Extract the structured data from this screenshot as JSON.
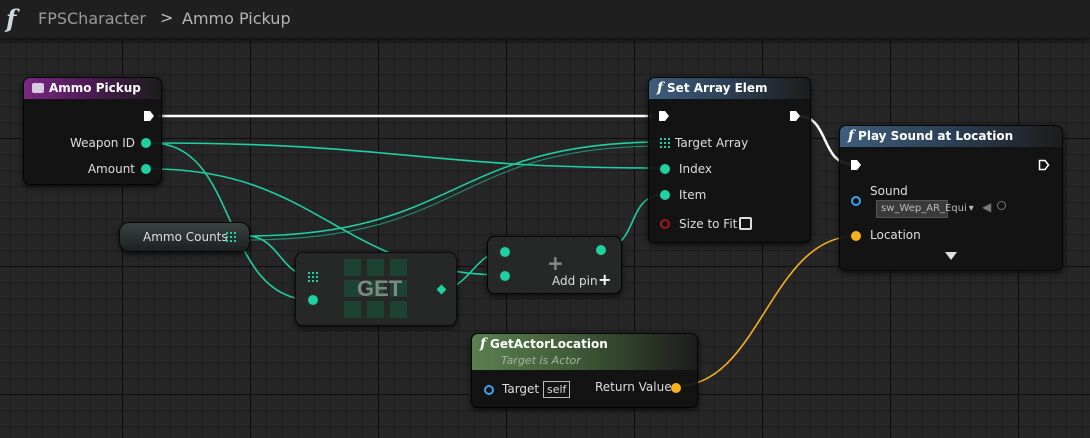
{
  "breadcrumb": {
    "graph": "FPSCharacter",
    "separator": ">",
    "function": "Ammo Pickup",
    "icon": "function-icon"
  },
  "nodes": {
    "ammo_pickup": {
      "title": "Ammo Pickup",
      "outputs": [
        "Weapon ID",
        "Amount"
      ]
    },
    "ammo_counts": {
      "label": "Ammo Counts"
    },
    "get": {
      "label": "GET"
    },
    "add": {
      "symbol": "+",
      "add_pin": "Add pin",
      "add_pin_icon": "+"
    },
    "set_array_elem": {
      "title": "Set Array Elem",
      "inputs": [
        "Target Array",
        "Index",
        "Item",
        "Size to Fit"
      ]
    },
    "play_sound": {
      "title": "Play Sound at Location",
      "sound_label": "Sound",
      "sound_value": "sw_Wep_AR_Equi",
      "location_label": "Location"
    },
    "get_actor_location": {
      "title": "GetActorLocation",
      "subtitle": "Target is Actor",
      "target_label": "Target",
      "target_default": "self",
      "return_label": "Return Value"
    }
  },
  "colors": {
    "integer_pin": "#1fd0a0",
    "vector_pin": "#f5b21e",
    "object_pin": "#3aa3f0",
    "bool_pin": "#a01818",
    "exec_wire": "#ffffff",
    "event_header": "#7a2a82",
    "function_header": "#3e5d7d",
    "pure_function_header": "#5b7f4f"
  }
}
